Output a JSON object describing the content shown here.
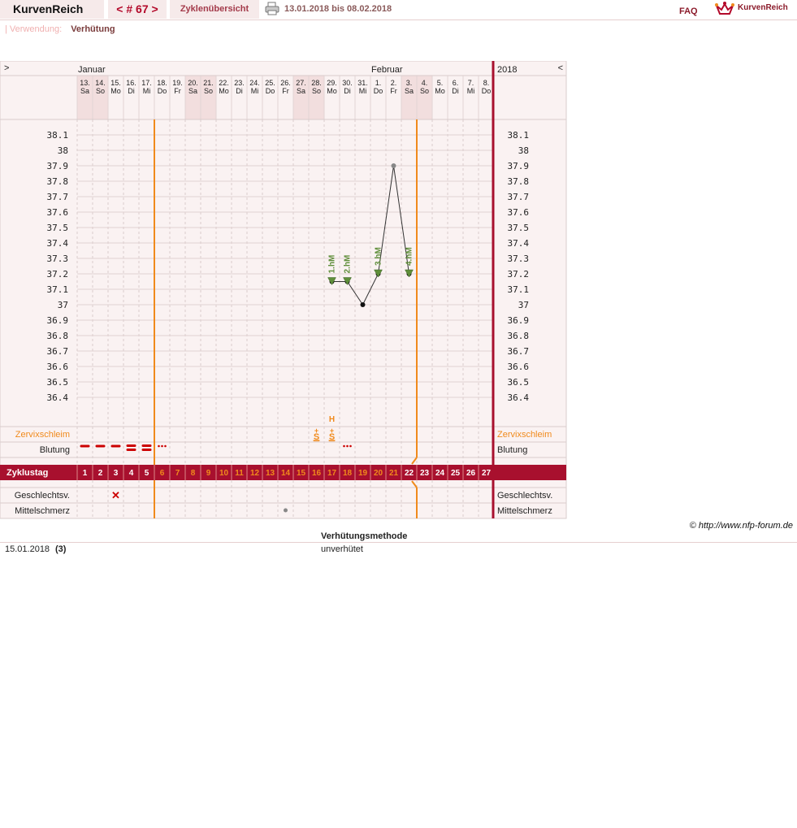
{
  "header": {
    "brand": "KurvenReich",
    "cycle_number": "< # 67 >",
    "overview_label": "Zyklenübersicht",
    "date_range": "13.01.2018 bis 08.02.2018",
    "faq_label": "FAQ",
    "logo_text": "KurvenReich",
    "print_icon": "printer-icon"
  },
  "usage": {
    "label": "Verwendung:",
    "value": "Verhütung"
  },
  "chart_data": {
    "type": "line",
    "nav_prev": ">",
    "nav_next": "<",
    "year": "2018",
    "months": [
      {
        "label": "Januar",
        "start_index": 0
      },
      {
        "label": "Februar",
        "start_index": 19
      }
    ],
    "days": [
      {
        "date": "13.",
        "wd": "Sa",
        "weekend": true
      },
      {
        "date": "14.",
        "wd": "So",
        "weekend": true
      },
      {
        "date": "15.",
        "wd": "Mo",
        "weekend": false
      },
      {
        "date": "16.",
        "wd": "Di",
        "weekend": false
      },
      {
        "date": "17.",
        "wd": "Mi",
        "weekend": false
      },
      {
        "date": "18.",
        "wd": "Do",
        "weekend": false
      },
      {
        "date": "19.",
        "wd": "Fr",
        "weekend": false
      },
      {
        "date": "20.",
        "wd": "Sa",
        "weekend": true
      },
      {
        "date": "21.",
        "wd": "So",
        "weekend": true
      },
      {
        "date": "22.",
        "wd": "Mo",
        "weekend": false
      },
      {
        "date": "23.",
        "wd": "Di",
        "weekend": false
      },
      {
        "date": "24.",
        "wd": "Mi",
        "weekend": false
      },
      {
        "date": "25.",
        "wd": "Do",
        "weekend": false
      },
      {
        "date": "26.",
        "wd": "Fr",
        "weekend": false
      },
      {
        "date": "27.",
        "wd": "Sa",
        "weekend": true
      },
      {
        "date": "28.",
        "wd": "So",
        "weekend": true
      },
      {
        "date": "29.",
        "wd": "Mo",
        "weekend": false
      },
      {
        "date": "30.",
        "wd": "Di",
        "weekend": false
      },
      {
        "date": "31.",
        "wd": "Mi",
        "weekend": false
      },
      {
        "date": "1.",
        "wd": "Do",
        "weekend": false
      },
      {
        "date": "2.",
        "wd": "Fr",
        "weekend": false
      },
      {
        "date": "3.",
        "wd": "Sa",
        "weekend": true
      },
      {
        "date": "4.",
        "wd": "So",
        "weekend": true
      },
      {
        "date": "5.",
        "wd": "Mo",
        "weekend": false
      },
      {
        "date": "6.",
        "wd": "Di",
        "weekend": false
      },
      {
        "date": "7.",
        "wd": "Mi",
        "weekend": false
      },
      {
        "date": "8.",
        "wd": "Do",
        "weekend": false
      }
    ],
    "y_ticks": [
      "38.1",
      "38",
      "37.9",
      "37.8",
      "37.7",
      "37.6",
      "37.5",
      "37.4",
      "37.3",
      "37.2",
      "37.1",
      "37",
      "36.9",
      "36.8",
      "36.7",
      "36.6",
      "36.5",
      "36.4"
    ],
    "ylim": [
      36.4,
      38.1
    ],
    "temperatures": [
      {
        "day": 17,
        "value": 37.15
      },
      {
        "day": 18,
        "value": 37.15
      },
      {
        "day": 19,
        "value": 37.0
      },
      {
        "day": 20,
        "value": 37.2
      },
      {
        "day": 21,
        "value": 37.9
      },
      {
        "day": 22,
        "value": 37.2
      }
    ],
    "markers": [
      {
        "day": 17,
        "label": "1.hM",
        "value": 37.15
      },
      {
        "day": 18,
        "label": "2.hM",
        "value": 37.15
      },
      {
        "day": 20,
        "label": "3.hM",
        "value": 37.2
      },
      {
        "day": 22,
        "label": "4.hM",
        "value": 37.2
      }
    ],
    "cycle_days": [
      1,
      2,
      3,
      4,
      5,
      6,
      7,
      8,
      9,
      10,
      11,
      12,
      13,
      14,
      15,
      16,
      17,
      18,
      19,
      20,
      21,
      22,
      23,
      24,
      25,
      26,
      27
    ],
    "fertile_window": {
      "start_day": 6,
      "end_day": 22
    },
    "zervix_marks": [
      {
        "day": 16,
        "symbol": "S+"
      },
      {
        "day": 17,
        "symbol": "S+",
        "top": "H"
      }
    ],
    "bleeding": [
      {
        "day": 1,
        "kind": "strong"
      },
      {
        "day": 2,
        "kind": "strong"
      },
      {
        "day": 3,
        "kind": "strong"
      },
      {
        "day": 4,
        "kind": "double"
      },
      {
        "day": 5,
        "kind": "double"
      },
      {
        "day": 6,
        "kind": "spotting"
      },
      {
        "day": 18,
        "kind": "spotting"
      }
    ],
    "intercourse": [
      {
        "day": 3,
        "symbol": "✕"
      }
    ],
    "pain": [
      {
        "day": 14,
        "symbol": "●"
      }
    ],
    "row_labels": {
      "cervix": "Zervixschleim",
      "bleeding": "Blutung",
      "cycle_day": "Zyklustag",
      "intercourse": "Geschlechtsv.",
      "pain": "Mittelschmerz"
    },
    "colors": {
      "accent": "#a8102e",
      "orange": "#f08a1c",
      "green": "#5f8e3a",
      "weekend": "#f2dede",
      "bg": "#faf2f2",
      "grid": "#d9cccc",
      "bleed": "#cc0000"
    }
  },
  "copyright": "© http://www.nfp-forum.de",
  "methods": {
    "header": "Verhütungsmethode",
    "rows": [
      {
        "date": "15.01.2018",
        "note": "(3)",
        "value": "unverhütet"
      }
    ]
  }
}
